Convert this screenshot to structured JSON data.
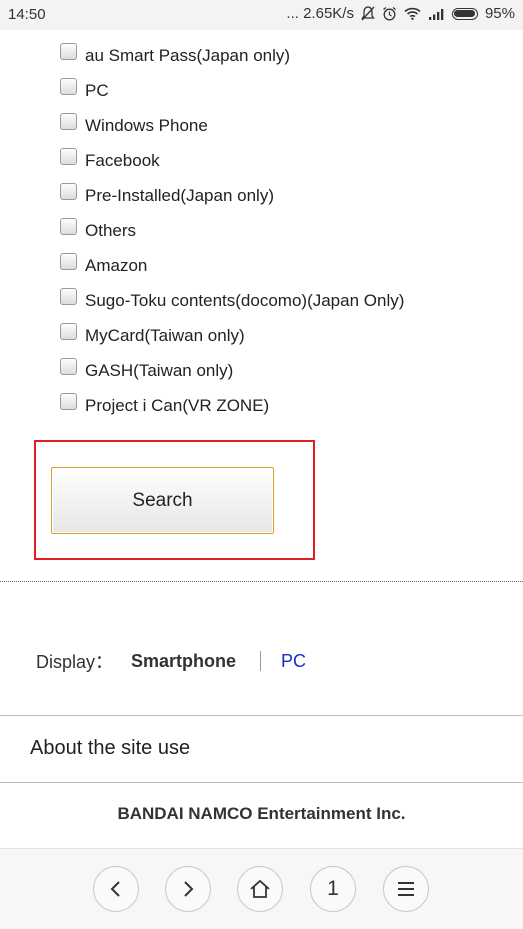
{
  "status_bar": {
    "time": "14:50",
    "network_speed": "... 2.65K/s",
    "battery": "95%"
  },
  "clipped_row_text": "",
  "checkbox_items": [
    "au Smart Pass(Japan only)",
    "PC",
    "Windows Phone",
    "Facebook",
    "Pre-Installed(Japan only)",
    "Others",
    "Amazon",
    "Sugo-Toku contents(docomo)(Japan Only)",
    "MyCard(Taiwan only)",
    "GASH(Taiwan only)",
    "Project i Can(VR ZONE)"
  ],
  "search": {
    "button_label": "Search"
  },
  "display": {
    "label": "Display：",
    "smartphone": "Smartphone",
    "pc": "PC"
  },
  "footer": {
    "about": "About the site use",
    "company": "BANDAI NAMCO Entertainment Inc."
  },
  "browser_nav": {
    "back_icon": "chevron-left-icon",
    "forward_icon": "chevron-right-icon",
    "home_icon": "home-icon",
    "tab_count": "1",
    "menu_icon": "menu-icon"
  },
  "colors": {
    "highlight_border": "#e02020",
    "button_border": "#e2a020",
    "link": "#1a2bd0"
  }
}
